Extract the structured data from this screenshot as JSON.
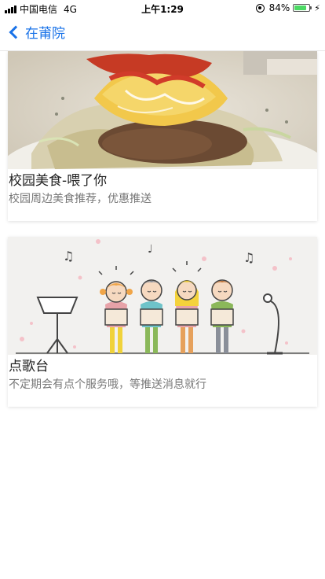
{
  "status_bar": {
    "carrier": "中国电信",
    "network": "4G",
    "time": "上午1:29",
    "battery_percent": "84%",
    "battery_level": 0.84
  },
  "nav": {
    "back_label": "在莆院"
  },
  "cards": [
    {
      "title": "校园美食-喂了你",
      "description": "校园周边美食推荐，优惠推送",
      "image_icon": "food-dish-image"
    },
    {
      "title": "点歌台",
      "description": "不定期会有点个服务哦，等推送消息就行",
      "image_icon": "singing-choir-image"
    }
  ],
  "colors": {
    "accent": "#1a73e8",
    "battery": "#4cd964"
  }
}
